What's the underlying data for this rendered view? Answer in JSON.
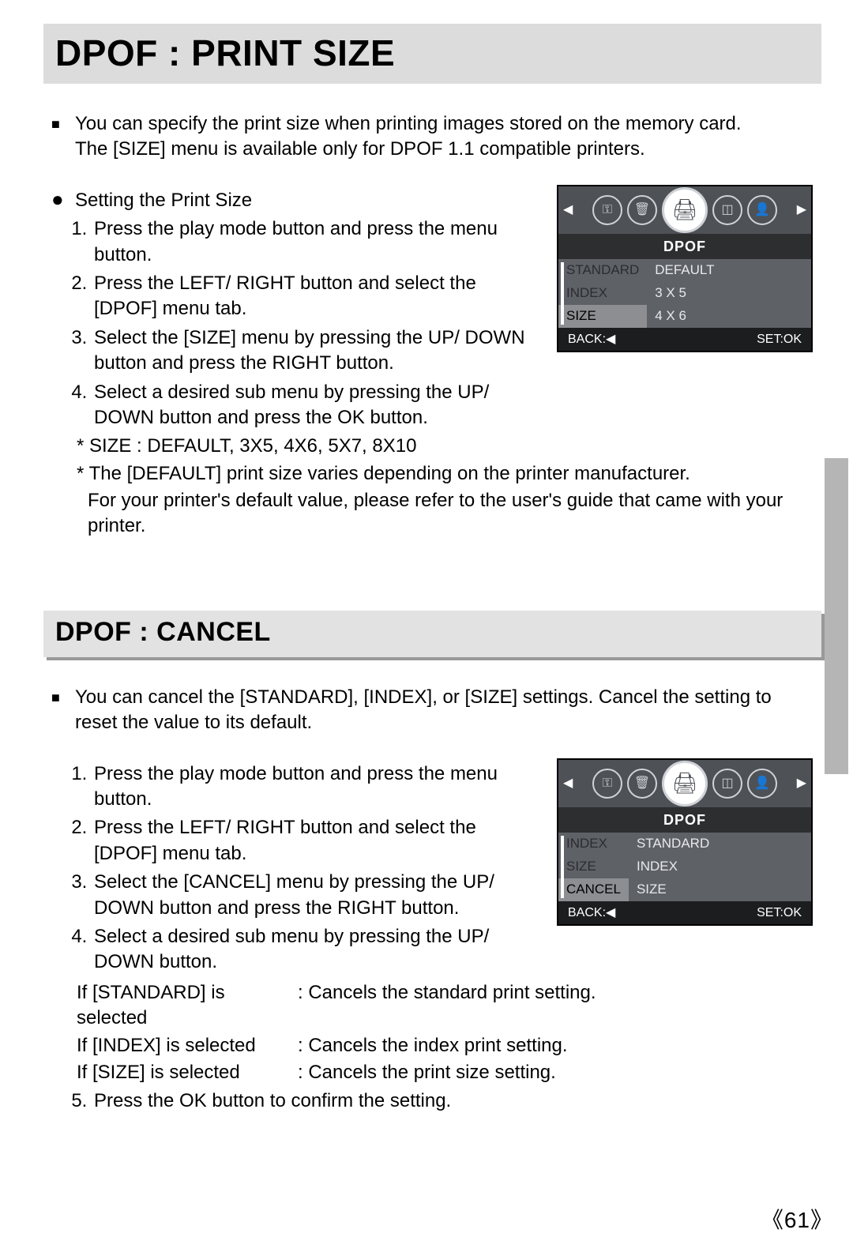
{
  "page_number": "《61》",
  "section1": {
    "title": "DPOF : PRINT SIZE",
    "intro1": "You can specify the print size when printing images stored on the memory card.",
    "intro2": "The [SIZE] menu is available only for DPOF 1.1 compatible printers.",
    "sub_heading": "Setting the Print Size",
    "steps": [
      "Press the play mode button and press the menu button.",
      "Press the LEFT/ RIGHT button and select the [DPOF] menu tab.",
      "Select the [SIZE] menu by pressing the UP/ DOWN button and press the RIGHT button.",
      "Select a desired sub menu by pressing the UP/ DOWN button and press the OK button."
    ],
    "note1": "* SIZE : DEFAULT, 3X5, 4X6, 5X7, 8X10",
    "note2": "* The [DEFAULT] print size varies depending on the printer manufacturer.",
    "note3": "For your printer's default value, please refer to the user's guide that came with your printer.",
    "lcd": {
      "title": "DPOF",
      "left": [
        "STANDARD",
        "INDEX",
        "SIZE"
      ],
      "right": [
        "DEFAULT",
        "3 X 5",
        "4 X 6"
      ],
      "selected_left_index": 2,
      "foot_left": "BACK:◀",
      "foot_right": "SET:OK"
    }
  },
  "section2": {
    "title": "DPOF : CANCEL",
    "intro": "You can cancel the [STANDARD], [INDEX], or [SIZE] settings. Cancel the setting to reset the value to its default.",
    "steps": [
      "Press the play mode button and press the menu button.",
      "Press the LEFT/ RIGHT button and select the [DPOF] menu tab.",
      "Select the [CANCEL] menu by pressing the UP/ DOWN button and press the RIGHT button.",
      "Select a desired sub menu by pressing the UP/ DOWN button."
    ],
    "conds": [
      {
        "label": "If [STANDARD] is selected",
        "desc": ": Cancels the standard print setting."
      },
      {
        "label": "If [INDEX] is selected",
        "desc": ": Cancels the index print setting."
      },
      {
        "label": "If [SIZE] is selected",
        "desc": ": Cancels the print size setting."
      }
    ],
    "step5": "Press the OK button to confirm the setting.",
    "lcd": {
      "title": "DPOF",
      "left": [
        "INDEX",
        "SIZE",
        "CANCEL"
      ],
      "right": [
        "STANDARD",
        "INDEX",
        "SIZE"
      ],
      "selected_left_index": 2,
      "foot_left": "BACK:◀",
      "foot_right": "SET:OK"
    }
  },
  "icons": {
    "key": "⚿",
    "trash": "🗑",
    "print": "🖨",
    "frame": "◫",
    "head": "👤"
  }
}
